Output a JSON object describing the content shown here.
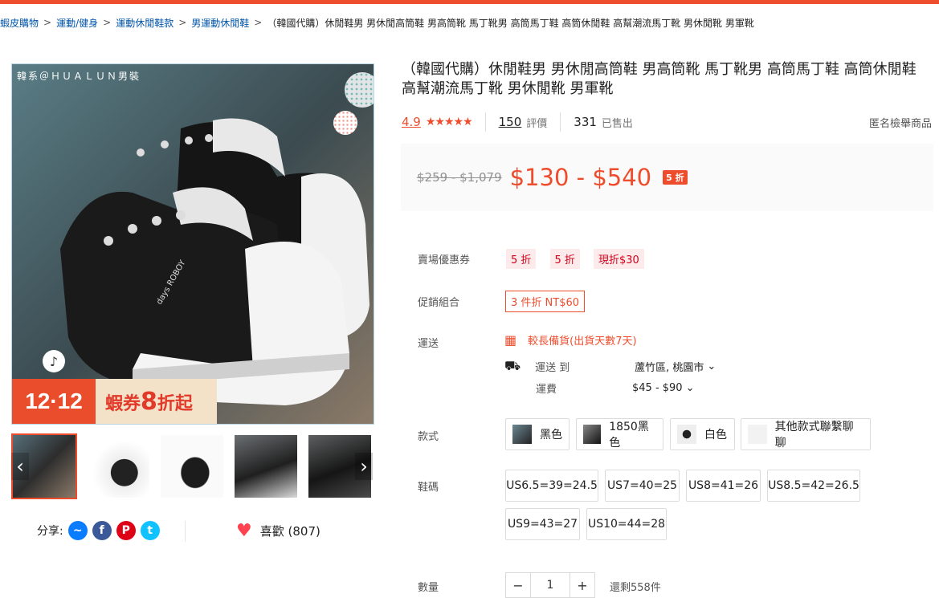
{
  "breadcrumb": [
    "蝦皮購物",
    "運動/健身",
    "運動休閒鞋款",
    "男運動休閒鞋",
    "（韓國代購）休閒鞋男 男休閒高筒鞋 男高筒靴 馬丁靴男 高筒馬丁鞋 高筒休閒鞋 高幫潮流馬丁靴 男休閒靴 男軍靴"
  ],
  "gallery": {
    "brand_text": "韓系＠ＨＵＡＬＵＮ男裝",
    "promo_date": "12·12",
    "promo_text": "蝦券",
    "promo_discount": "8",
    "promo_suffix": "折起"
  },
  "product": {
    "title": "（韓國代購）休閒鞋男 男休閒高筒鞋 男高筒靴 馬丁靴男 高筒馬丁鞋 高筒休閒鞋 高幫潮流馬丁靴 男休閒靴 男軍靴",
    "rating": "4.9",
    "stars": "★★★★★",
    "reviews": "150",
    "reviews_label": "評價",
    "sold": "331",
    "sold_label": "已售出",
    "report": "匿名檢舉商品",
    "orig_price": "$259 - $1,079",
    "price": "$130 - $540",
    "discount": "5 折"
  },
  "rows": {
    "voucher_label": "賣場優惠券",
    "vouchers": [
      "5 折",
      "5 折",
      "現折$30"
    ],
    "combo_label": "促銷組合",
    "combo": "3 件折 NT$60",
    "ship_label": "運送",
    "ship_note": "較長備貨(出貨天數7天)",
    "ship_to_label": "運送 到",
    "ship_to": "蘆竹區, 桃園市",
    "fee_label": "運費",
    "fee": "$45 - $90",
    "style_label": "款式",
    "styles": [
      "黑色",
      "1850黑色",
      "白色",
      "其他款式聯繫聊聊"
    ],
    "size_label": "鞋碼",
    "sizes": [
      "US6.5=39=24.5",
      "US7=40=25",
      "US8=41=26",
      "US8.5=42=26.5",
      "US9=43=27",
      "US10=44=28"
    ],
    "qty_label": "數量",
    "qty": "1",
    "stock": "還剩558件"
  },
  "share": {
    "label": "分享:",
    "icons": [
      "messenger-icon",
      "facebook-icon",
      "pinterest-icon",
      "twitter-icon"
    ]
  },
  "like": {
    "label": "喜歡 (807)"
  },
  "colors": {
    "accent": "#ee4d2d",
    "link": "#0055aa"
  }
}
